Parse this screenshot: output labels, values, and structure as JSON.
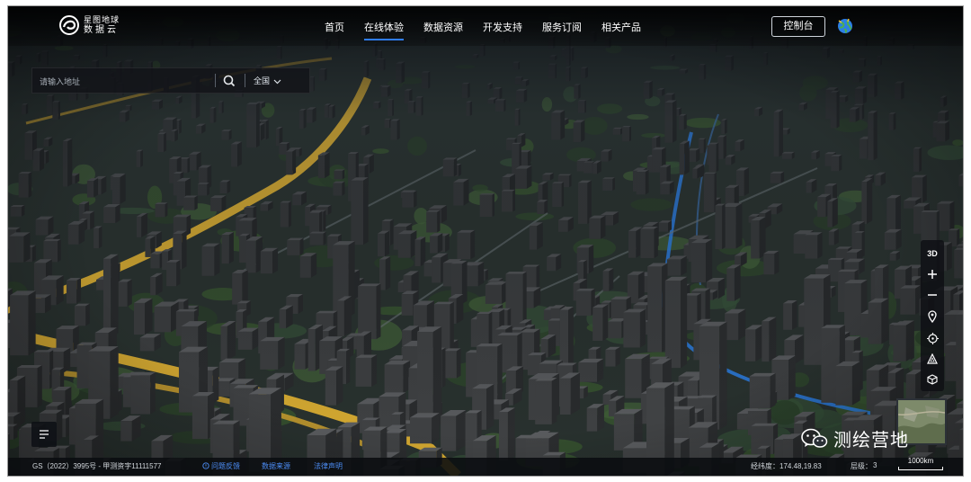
{
  "header": {
    "logo_line1": "星图地球",
    "logo_line2": "数据云",
    "nav": [
      {
        "label": "首页",
        "active": false
      },
      {
        "label": "在线体验",
        "active": true
      },
      {
        "label": "数据资源",
        "active": false
      },
      {
        "label": "开发支持",
        "active": false
      },
      {
        "label": "服务订阅",
        "active": false
      },
      {
        "label": "相关产品",
        "active": false
      }
    ],
    "console_label": "控制台"
  },
  "search": {
    "placeholder": "请输入地址",
    "region_label": "全国"
  },
  "tools": {
    "mode_3d_label": "3D"
  },
  "watermark": {
    "text": "测绘营地"
  },
  "status": {
    "license": "GS（2022）3995号 - 甲测资字11111577",
    "feedback": "问题反馈",
    "data_source": "数据来源",
    "legal": "法律声明",
    "coord_label": "经纬度：174.48,19.83",
    "level_label": "层级：",
    "level_value": "3",
    "scale_label": "1000km"
  },
  "colors": {
    "accent_blue": "#2f7cf6",
    "road_yellow": "#e0b233",
    "river_blue": "#2c7fe6"
  }
}
